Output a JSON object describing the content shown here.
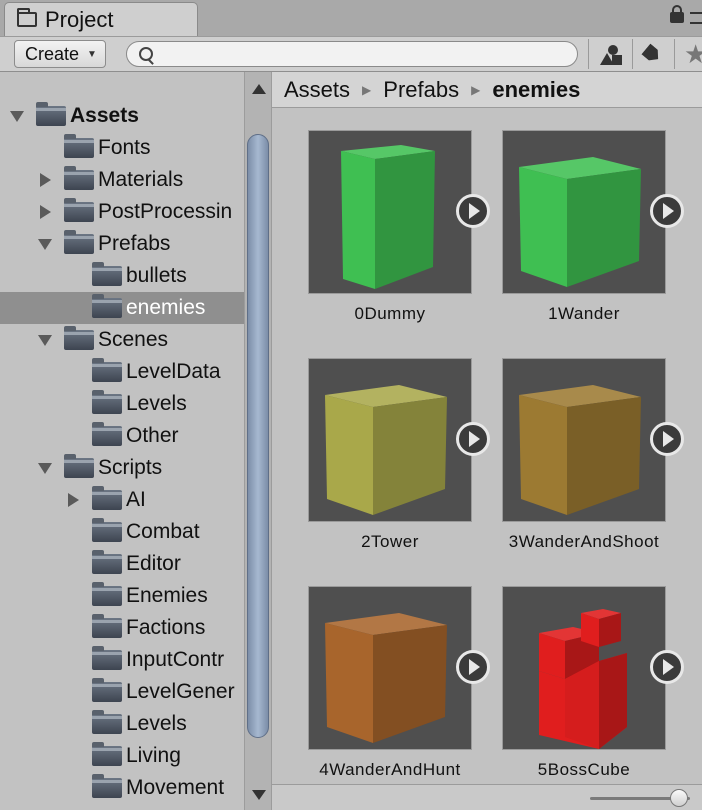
{
  "window": {
    "tab_title": "Project"
  },
  "toolbar": {
    "create_label": "Create",
    "search_placeholder": ""
  },
  "tree": [
    {
      "label": "Assets",
      "depth": 0,
      "arrow": "open",
      "bold": true
    },
    {
      "label": "Fonts",
      "depth": 1,
      "arrow": "none"
    },
    {
      "label": "Materials",
      "depth": 1,
      "arrow": "closed"
    },
    {
      "label": "PostProcessin",
      "depth": 1,
      "arrow": "closed"
    },
    {
      "label": "Prefabs",
      "depth": 1,
      "arrow": "open"
    },
    {
      "label": "bullets",
      "depth": 2,
      "arrow": "none"
    },
    {
      "label": "enemies",
      "depth": 2,
      "arrow": "none",
      "selected": true
    },
    {
      "label": "Scenes",
      "depth": 1,
      "arrow": "open"
    },
    {
      "label": "LevelData",
      "depth": 2,
      "arrow": "none"
    },
    {
      "label": "Levels",
      "depth": 2,
      "arrow": "none"
    },
    {
      "label": "Other",
      "depth": 2,
      "arrow": "none"
    },
    {
      "label": "Scripts",
      "depth": 1,
      "arrow": "open"
    },
    {
      "label": "AI",
      "depth": 2,
      "arrow": "closed"
    },
    {
      "label": "Combat",
      "depth": 2,
      "arrow": "none"
    },
    {
      "label": "Editor",
      "depth": 2,
      "arrow": "none"
    },
    {
      "label": "Enemies",
      "depth": 2,
      "arrow": "none"
    },
    {
      "label": "Factions",
      "depth": 2,
      "arrow": "none"
    },
    {
      "label": "InputContr",
      "depth": 2,
      "arrow": "none"
    },
    {
      "label": "LevelGener",
      "depth": 2,
      "arrow": "none"
    },
    {
      "label": "Levels",
      "depth": 2,
      "arrow": "none"
    },
    {
      "label": "Living",
      "depth": 2,
      "arrow": "none"
    },
    {
      "label": "Movement",
      "depth": 2,
      "arrow": "none"
    }
  ],
  "breadcrumb": {
    "items": [
      "Assets",
      "Prefabs",
      "enemies"
    ]
  },
  "assets": [
    {
      "name": "0Dummy",
      "shape": "tall-cube",
      "color": "#3fbf52"
    },
    {
      "name": "1Wander",
      "shape": "cube",
      "color": "#3fbf52"
    },
    {
      "name": "2Tower",
      "shape": "cube",
      "color": "#a9a84a"
    },
    {
      "name": "3WanderAndShoot",
      "shape": "cube",
      "color": "#9c7a32"
    },
    {
      "name": "4WanderAndHunt",
      "shape": "cube",
      "color": "#a8652c"
    },
    {
      "name": "5BossCube",
      "shape": "boss-cube",
      "color": "#e01e1e"
    }
  ],
  "icons": {
    "tab": "folder-icon",
    "search": "search-icon",
    "filter_type": "filter-by-type-icon",
    "filter_label": "tag-icon",
    "favorite": "star-icon"
  }
}
